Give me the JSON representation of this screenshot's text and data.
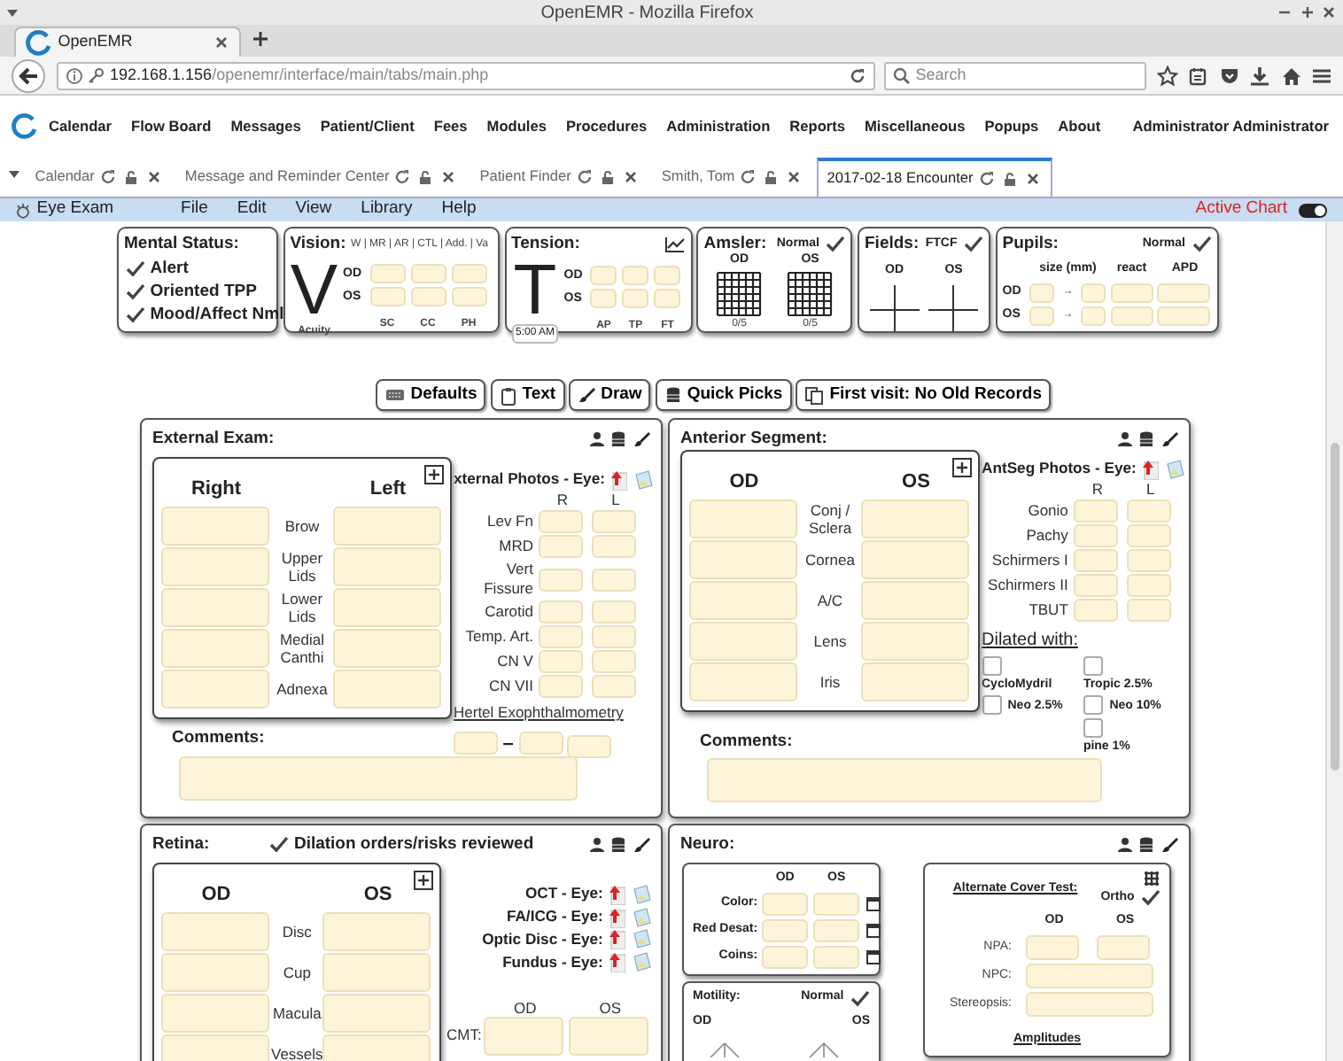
{
  "browser": {
    "title": "OpenEMR - Mozilla Firefox",
    "tab": "OpenEMR",
    "url_host": "192.168.1.156",
    "url_path": "/openemr/interface/main/tabs/main.php",
    "search_placeholder": "Search"
  },
  "app_menu": {
    "items": [
      "Calendar",
      "Flow Board",
      "Messages",
      "Patient/Client",
      "Fees",
      "Modules",
      "Procedures",
      "Administration",
      "Reports",
      "Miscellaneous",
      "Popups",
      "About"
    ],
    "user": "Administrator Administrator"
  },
  "app_tabs": [
    {
      "label": "Calendar",
      "selected": false
    },
    {
      "label": "Message and Reminder Center",
      "selected": false
    },
    {
      "label": "Patient Finder",
      "selected": false
    },
    {
      "label": "Smith, Tom",
      "selected": false
    },
    {
      "label": "2017-02-18 Encounter",
      "selected": true
    }
  ],
  "eye_menu": {
    "title": "Eye Exam",
    "items": [
      "File",
      "Edit",
      "View",
      "Library",
      "Help"
    ],
    "status": "Active Chart",
    "toggle_on": true
  },
  "mental_status": {
    "title": "Mental Status:",
    "items": [
      {
        "label": "Alert",
        "checked": true
      },
      {
        "label": "Oriented TPP",
        "checked": true
      },
      {
        "label": "Mood/Affect Nml",
        "checked": true
      }
    ]
  },
  "vision": {
    "title": "Vision:",
    "modes": "W | MR | AR | CTL | Add. | Va",
    "letter": "V",
    "sub": "Acuity",
    "rows": [
      "OD",
      "OS"
    ],
    "columns": [
      "SC",
      "CC",
      "PH"
    ]
  },
  "tension": {
    "title": "Tension:",
    "letter": "T",
    "time": "5:00 AM",
    "rows": [
      "OD",
      "OS"
    ],
    "columns": [
      "AP",
      "TP",
      "FT"
    ]
  },
  "amsler": {
    "title": "Amsler:",
    "normal_label": "Normal",
    "normal": true,
    "eyes": [
      "OD",
      "OS"
    ],
    "values": [
      "0/5",
      "0/5"
    ]
  },
  "fields": {
    "title": "Fields:",
    "ftcf_label": "FTCF",
    "ftcf": true,
    "eyes": [
      "OD",
      "OS"
    ]
  },
  "pupils": {
    "title": "Pupils:",
    "normal_label": "Normal",
    "normal": true,
    "columns": [
      "size (mm)",
      "react",
      "APD"
    ],
    "rows": [
      "OD",
      "OS"
    ],
    "arrow": "→"
  },
  "toolbar": [
    {
      "label": "Defaults"
    },
    {
      "label": "Text"
    },
    {
      "label": "Draw"
    },
    {
      "label": "Quick Picks"
    },
    {
      "label": "First visit: No Old Records"
    }
  ],
  "external": {
    "title": "External Exam:",
    "col_a": "Right",
    "col_b": "Left",
    "rows": [
      "Brow",
      "Upper Lids",
      "Lower Lids",
      "Medial Canthi",
      "Adnexa"
    ],
    "photos": "xternal Photos - Eye:",
    "measure_cols": [
      "R",
      "L"
    ],
    "measures": [
      "Lev Fn",
      "MRD",
      "Vert Fissure",
      "Carotid",
      "Temp. Art.",
      "CN V",
      "CN VII"
    ],
    "hertel": "Hertel Exophthalmometry",
    "hertel_dash": "–",
    "comments": "Comments:"
  },
  "anterior": {
    "title": "Anterior Segment:",
    "col_a": "OD",
    "col_b": "OS",
    "rows": [
      "Conj / Sclera",
      "Cornea",
      "A/C",
      "Lens",
      "Iris"
    ],
    "photos": "AntSeg Photos - Eye:",
    "measure_cols": [
      "R",
      "L"
    ],
    "measures": [
      "Gonio",
      "Pachy",
      "Schirmers I",
      "Schirmers II",
      "TBUT"
    ],
    "dilated": "Dilated with:",
    "drugs": [
      {
        "label": "CycloMydril",
        "checked": false,
        "kind": "stacked"
      },
      {
        "label": "Tropic 2.5%",
        "checked": false,
        "kind": "stacked"
      },
      {
        "label": "Neo 2.5%",
        "checked": false,
        "kind": "inline"
      },
      {
        "label": "Neo 10%",
        "checked": false,
        "kind": "inline"
      },
      {
        "label": "pine 1%",
        "checked": false,
        "kind": "stacked"
      }
    ],
    "comments": "Comments:"
  },
  "retina": {
    "title": "Retina:",
    "dilation_label": "Dilation orders/risks reviewed",
    "dilation": true,
    "col_a": "OD",
    "col_b": "OS",
    "rows": [
      "Disc",
      "Cup",
      "Macula",
      "Vessels"
    ],
    "photos": [
      "OCT - Eye:",
      "FA/ICG - Eye:",
      "Optic Disc - Eye:",
      "Fundus - Eye:"
    ],
    "cmt_cols": [
      "OD",
      "OS"
    ],
    "cmt_label": "CMT:"
  },
  "neuro": {
    "title": "Neuro:",
    "cols": [
      "OD",
      "OS"
    ],
    "color_rows": [
      "Color:",
      "Red Desat:",
      "Coins:"
    ],
    "motility": {
      "title": "Motility:",
      "normal_label": "Normal",
      "normal": true,
      "eyes": [
        "OD",
        "OS"
      ]
    },
    "cover": {
      "title": "Alternate Cover Test:",
      "ortho_label": "Ortho",
      "ortho": true,
      "cols": [
        "OD",
        "OS"
      ],
      "rows": [
        {
          "label": "NPA:",
          "kind": "pair"
        },
        {
          "label": "NPC:",
          "kind": "wide"
        },
        {
          "label": "Stereopsis:",
          "kind": "wide"
        }
      ],
      "amplitudes": "Amplitudes"
    }
  }
}
